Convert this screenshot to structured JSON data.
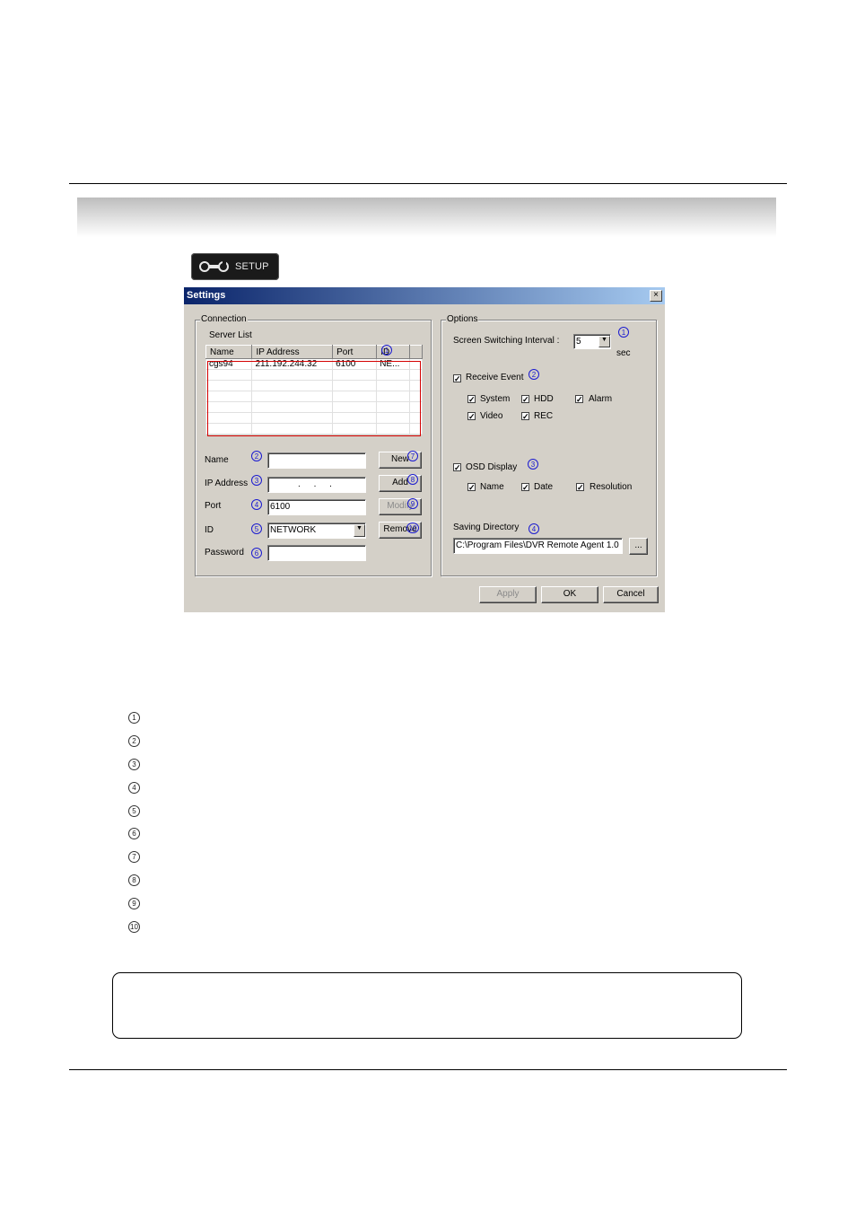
{
  "setup_button": {
    "label": "SETUP"
  },
  "dialog": {
    "title": "Settings",
    "close_label": "×",
    "connection": {
      "group_label": "Connection",
      "server_list_label": "Server List",
      "columns": [
        "Name",
        "IP Address",
        "Port",
        "ID"
      ],
      "rows": [
        [
          "cgs94",
          "211.192.244.32",
          "6100",
          "NE..."
        ]
      ],
      "name_label": "Name",
      "name_value": "",
      "ip_label": "IP Address",
      "ip_value": ".  .  .",
      "port_label": "Port",
      "port_value": "6100",
      "id_label": "ID",
      "id_value": "NETWORK",
      "password_label": "Password",
      "password_value": "",
      "new_button": "New",
      "add_button": "Add",
      "modify_button": "Modify",
      "remove_button": "Remove"
    },
    "options": {
      "group_label": "Options",
      "interval_label": "Screen Switching Interval :",
      "interval_value": "5",
      "interval_unit": "sec",
      "receive_event_label": "Receive Event",
      "system_label": "System",
      "hdd_label": "HDD",
      "alarm_label": "Alarm",
      "video_label": "Video",
      "rec_label": "REC",
      "osd_label": "OSD Display",
      "osd_name_label": "Name",
      "osd_date_label": "Date",
      "osd_resolution_label": "Resolution",
      "saving_dir_label": "Saving Directory",
      "saving_dir_value": "C:\\Program Files\\DVR Remote Agent 1.0",
      "browse_label": "..."
    },
    "apply_button": "Apply",
    "ok_button": "OK",
    "cancel_button": "Cancel",
    "check_mark": "✓"
  },
  "callout_numbers": [
    "1",
    "2",
    "3",
    "4",
    "5",
    "6",
    "7",
    "8",
    "9",
    "10"
  ],
  "list_numbers": [
    "1",
    "2",
    "3",
    "4",
    "5",
    "6",
    "7",
    "8",
    "9",
    "10"
  ]
}
